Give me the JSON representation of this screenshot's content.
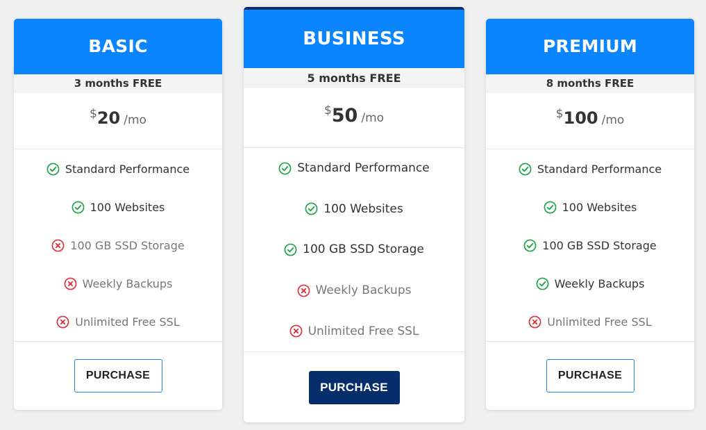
{
  "colors": {
    "header_blue": "#0a84ff",
    "featured_navy": "#062e6b",
    "check_green": "#22a447",
    "cross_red": "#d9343f"
  },
  "plans": [
    {
      "name": "BASIC",
      "promo": "3 months FREE",
      "currency": "$",
      "amount": "20",
      "period": "/mo",
      "features": [
        {
          "label": "Standard Performance",
          "included": true
        },
        {
          "label": "100 Websites",
          "included": true
        },
        {
          "label": "100 GB SSD Storage",
          "included": false
        },
        {
          "label": "Weekly Backups",
          "included": false
        },
        {
          "label": "Unlimited Free SSL",
          "included": false
        }
      ],
      "button": "PURCHASE",
      "featured": false
    },
    {
      "name": "BUSINESS",
      "promo": "5 months FREE",
      "currency": "$",
      "amount": "50",
      "period": "/mo",
      "features": [
        {
          "label": "Standard Performance",
          "included": true
        },
        {
          "label": "100 Websites",
          "included": true
        },
        {
          "label": "100 GB SSD Storage",
          "included": true
        },
        {
          "label": "Weekly Backups",
          "included": false
        },
        {
          "label": "Unlimited Free SSL",
          "included": false
        }
      ],
      "button": "PURCHASE",
      "featured": true
    },
    {
      "name": "PREMIUM",
      "promo": "8 months FREE",
      "currency": "$",
      "amount": "100",
      "period": "/mo",
      "features": [
        {
          "label": "Standard Performance",
          "included": true
        },
        {
          "label": "100 Websites",
          "included": true
        },
        {
          "label": "100 GB SSD Storage",
          "included": true
        },
        {
          "label": "Weekly Backups",
          "included": true
        },
        {
          "label": "Unlimited Free SSL",
          "included": false
        }
      ],
      "button": "PURCHASE",
      "featured": false
    }
  ]
}
